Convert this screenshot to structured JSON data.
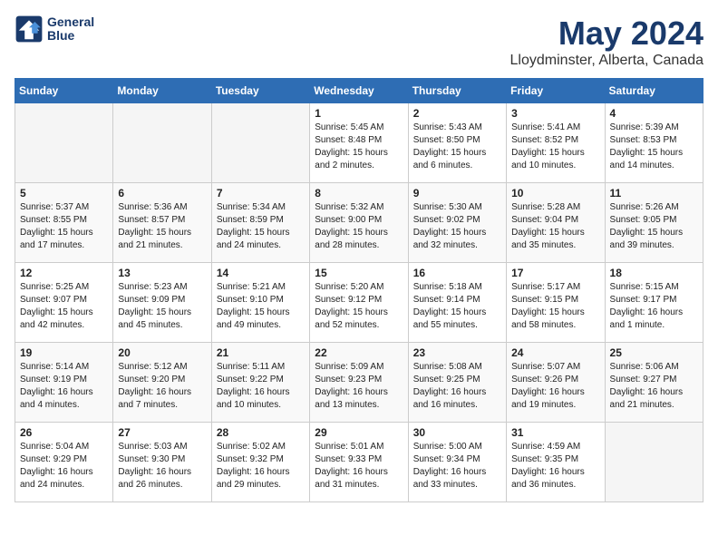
{
  "header": {
    "logo_line1": "General",
    "logo_line2": "Blue",
    "month_title": "May 2024",
    "location": "Lloydminster, Alberta, Canada"
  },
  "days_of_week": [
    "Sunday",
    "Monday",
    "Tuesday",
    "Wednesday",
    "Thursday",
    "Friday",
    "Saturday"
  ],
  "weeks": [
    [
      {
        "day": "",
        "info": ""
      },
      {
        "day": "",
        "info": ""
      },
      {
        "day": "",
        "info": ""
      },
      {
        "day": "1",
        "info": "Sunrise: 5:45 AM\nSunset: 8:48 PM\nDaylight: 15 hours\nand 2 minutes."
      },
      {
        "day": "2",
        "info": "Sunrise: 5:43 AM\nSunset: 8:50 PM\nDaylight: 15 hours\nand 6 minutes."
      },
      {
        "day": "3",
        "info": "Sunrise: 5:41 AM\nSunset: 8:52 PM\nDaylight: 15 hours\nand 10 minutes."
      },
      {
        "day": "4",
        "info": "Sunrise: 5:39 AM\nSunset: 8:53 PM\nDaylight: 15 hours\nand 14 minutes."
      }
    ],
    [
      {
        "day": "5",
        "info": "Sunrise: 5:37 AM\nSunset: 8:55 PM\nDaylight: 15 hours\nand 17 minutes."
      },
      {
        "day": "6",
        "info": "Sunrise: 5:36 AM\nSunset: 8:57 PM\nDaylight: 15 hours\nand 21 minutes."
      },
      {
        "day": "7",
        "info": "Sunrise: 5:34 AM\nSunset: 8:59 PM\nDaylight: 15 hours\nand 24 minutes."
      },
      {
        "day": "8",
        "info": "Sunrise: 5:32 AM\nSunset: 9:00 PM\nDaylight: 15 hours\nand 28 minutes."
      },
      {
        "day": "9",
        "info": "Sunrise: 5:30 AM\nSunset: 9:02 PM\nDaylight: 15 hours\nand 32 minutes."
      },
      {
        "day": "10",
        "info": "Sunrise: 5:28 AM\nSunset: 9:04 PM\nDaylight: 15 hours\nand 35 minutes."
      },
      {
        "day": "11",
        "info": "Sunrise: 5:26 AM\nSunset: 9:05 PM\nDaylight: 15 hours\nand 39 minutes."
      }
    ],
    [
      {
        "day": "12",
        "info": "Sunrise: 5:25 AM\nSunset: 9:07 PM\nDaylight: 15 hours\nand 42 minutes."
      },
      {
        "day": "13",
        "info": "Sunrise: 5:23 AM\nSunset: 9:09 PM\nDaylight: 15 hours\nand 45 minutes."
      },
      {
        "day": "14",
        "info": "Sunrise: 5:21 AM\nSunset: 9:10 PM\nDaylight: 15 hours\nand 49 minutes."
      },
      {
        "day": "15",
        "info": "Sunrise: 5:20 AM\nSunset: 9:12 PM\nDaylight: 15 hours\nand 52 minutes."
      },
      {
        "day": "16",
        "info": "Sunrise: 5:18 AM\nSunset: 9:14 PM\nDaylight: 15 hours\nand 55 minutes."
      },
      {
        "day": "17",
        "info": "Sunrise: 5:17 AM\nSunset: 9:15 PM\nDaylight: 15 hours\nand 58 minutes."
      },
      {
        "day": "18",
        "info": "Sunrise: 5:15 AM\nSunset: 9:17 PM\nDaylight: 16 hours\nand 1 minute."
      }
    ],
    [
      {
        "day": "19",
        "info": "Sunrise: 5:14 AM\nSunset: 9:19 PM\nDaylight: 16 hours\nand 4 minutes."
      },
      {
        "day": "20",
        "info": "Sunrise: 5:12 AM\nSunset: 9:20 PM\nDaylight: 16 hours\nand 7 minutes."
      },
      {
        "day": "21",
        "info": "Sunrise: 5:11 AM\nSunset: 9:22 PM\nDaylight: 16 hours\nand 10 minutes."
      },
      {
        "day": "22",
        "info": "Sunrise: 5:09 AM\nSunset: 9:23 PM\nDaylight: 16 hours\nand 13 minutes."
      },
      {
        "day": "23",
        "info": "Sunrise: 5:08 AM\nSunset: 9:25 PM\nDaylight: 16 hours\nand 16 minutes."
      },
      {
        "day": "24",
        "info": "Sunrise: 5:07 AM\nSunset: 9:26 PM\nDaylight: 16 hours\nand 19 minutes."
      },
      {
        "day": "25",
        "info": "Sunrise: 5:06 AM\nSunset: 9:27 PM\nDaylight: 16 hours\nand 21 minutes."
      }
    ],
    [
      {
        "day": "26",
        "info": "Sunrise: 5:04 AM\nSunset: 9:29 PM\nDaylight: 16 hours\nand 24 minutes."
      },
      {
        "day": "27",
        "info": "Sunrise: 5:03 AM\nSunset: 9:30 PM\nDaylight: 16 hours\nand 26 minutes."
      },
      {
        "day": "28",
        "info": "Sunrise: 5:02 AM\nSunset: 9:32 PM\nDaylight: 16 hours\nand 29 minutes."
      },
      {
        "day": "29",
        "info": "Sunrise: 5:01 AM\nSunset: 9:33 PM\nDaylight: 16 hours\nand 31 minutes."
      },
      {
        "day": "30",
        "info": "Sunrise: 5:00 AM\nSunset: 9:34 PM\nDaylight: 16 hours\nand 33 minutes."
      },
      {
        "day": "31",
        "info": "Sunrise: 4:59 AM\nSunset: 9:35 PM\nDaylight: 16 hours\nand 36 minutes."
      },
      {
        "day": "",
        "info": ""
      }
    ]
  ]
}
